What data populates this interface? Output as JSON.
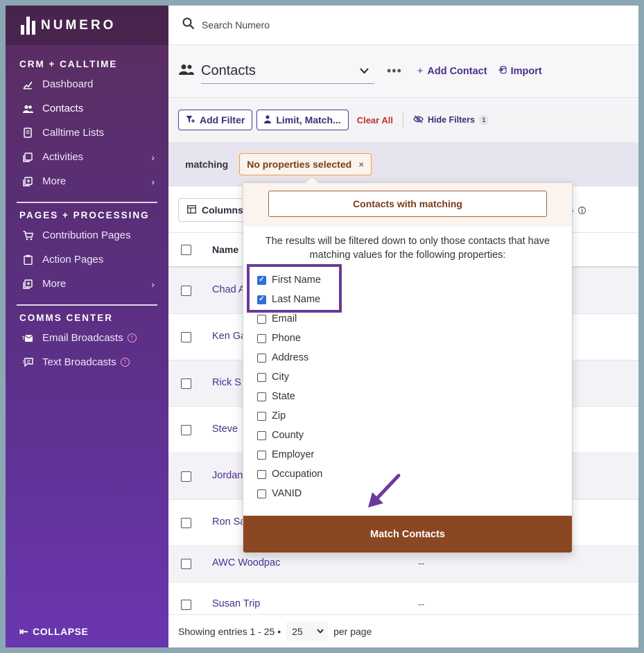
{
  "app": {
    "name": "NUMERO"
  },
  "search": {
    "placeholder": "Search Numero"
  },
  "sidebar": {
    "sections": [
      {
        "title": "CRM + CALLTIME",
        "items": [
          {
            "label": "Dashboard",
            "icon": "chart-icon"
          },
          {
            "label": "Contacts",
            "icon": "people-icon",
            "active": true
          },
          {
            "label": "Calltime Lists",
            "icon": "phone-list-icon"
          },
          {
            "label": "Activities",
            "icon": "activities-icon",
            "chevron": true
          },
          {
            "label": "More",
            "icon": "plus-box-icon",
            "chevron": true
          }
        ]
      },
      {
        "title": "PAGES + PROCESSING",
        "items": [
          {
            "label": "Contribution Pages",
            "icon": "cart-icon"
          },
          {
            "label": "Action Pages",
            "icon": "clipboard-icon"
          },
          {
            "label": "More",
            "icon": "plus-box-icon",
            "chevron": true
          }
        ]
      },
      {
        "title": "COMMS CENTER",
        "items": [
          {
            "label": "Email Broadcasts",
            "icon": "email-icon",
            "upgrade": true
          },
          {
            "label": "Text Broadcasts",
            "icon": "sms-icon",
            "upgrade": true
          }
        ]
      }
    ],
    "collapse_label": "COLLAPSE"
  },
  "header": {
    "view_label": "Contacts",
    "more_label": "•••",
    "add_contact_label": "Add Contact",
    "import_label": "Import"
  },
  "filters": {
    "add_filter_label": "Add Filter",
    "limit_label": "Limit, Match...",
    "clear_all_label": "Clear All",
    "hide_filters_label": "Hide Filters",
    "hide_filters_count": "1"
  },
  "matching": {
    "label": "matching",
    "pill_label": "No properties selected",
    "pill_close": "×"
  },
  "table": {
    "columns_button": "Columns",
    "counts_fragment": "ts",
    "name_header": "Name",
    "rows": [
      {
        "name": "Chad A",
        "value": ""
      },
      {
        "name": "Ken Ga",
        "value": ""
      },
      {
        "name": "Rick S",
        "value": ""
      },
      {
        "name": "Steve",
        "value": ""
      },
      {
        "name": "Jordan",
        "value": ""
      },
      {
        "name": "Ron Sa",
        "value": ""
      },
      {
        "name": "AWC Woodpac",
        "value": "--"
      },
      {
        "name": "Susan Trip",
        "value": "--"
      }
    ]
  },
  "footer": {
    "showing": "Showing entries 1 - 25 •",
    "per_page_value": "25",
    "per_page_label": "per page"
  },
  "popover": {
    "tab_label": "Contacts with matching",
    "description": "The results will be filtered down to only those contacts that have matching values for the following properties:",
    "options": [
      {
        "label": "First Name",
        "checked": true
      },
      {
        "label": "Last Name",
        "checked": true
      },
      {
        "label": "Email",
        "checked": false
      },
      {
        "label": "Phone",
        "checked": false
      },
      {
        "label": "Address",
        "checked": false
      },
      {
        "label": "City",
        "checked": false
      },
      {
        "label": "State",
        "checked": false
      },
      {
        "label": "Zip",
        "checked": false
      },
      {
        "label": "County",
        "checked": false
      },
      {
        "label": "Employer",
        "checked": false
      },
      {
        "label": "Occupation",
        "checked": false
      },
      {
        "label": "VANID",
        "checked": false
      }
    ],
    "submit_label": "Match Contacts"
  },
  "colors": {
    "brand_purple": "#4b2f8a",
    "accent_brown": "#8b4722",
    "highlight_purple": "#6b3a9a"
  }
}
